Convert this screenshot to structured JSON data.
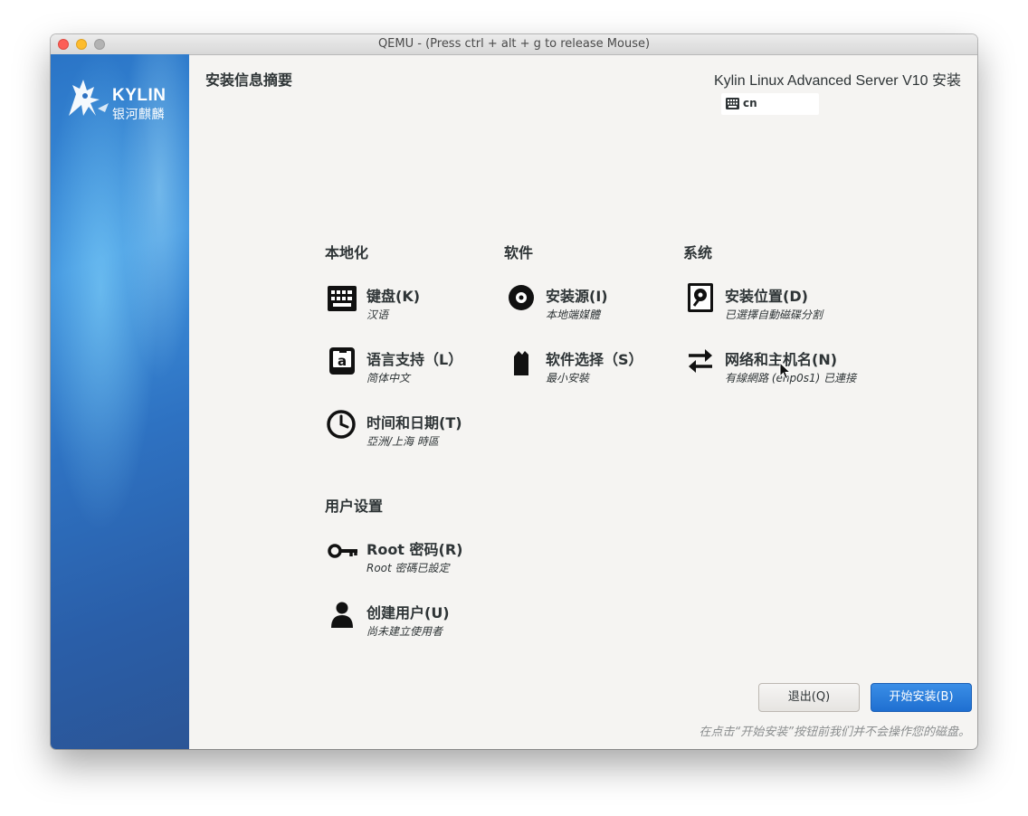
{
  "window": {
    "title": "QEMU - (Press ctrl + alt + g to release Mouse)"
  },
  "sidebar": {
    "logo_word": "KYLIN",
    "logo_cn": "银河麒麟",
    "logo_icon": "kylin-logo-icon"
  },
  "header": {
    "page_title": "安装信息摘要",
    "product_title": "Kylin Linux Advanced Server V10 安装",
    "keyboard_layout": "cn",
    "keyboard_icon": "keyboard-icon"
  },
  "sections": {
    "localization": {
      "title": "本地化",
      "spokes": [
        {
          "title": "键盘(K)",
          "status": "汉语",
          "icon": "keyboard-icon"
        },
        {
          "title": "语言支持（L）",
          "status": "简体中文",
          "icon": "language-icon"
        },
        {
          "title": "时间和日期(T)",
          "status": "亞洲/上海 時區",
          "icon": "clock-icon"
        }
      ]
    },
    "software": {
      "title": "软件",
      "spokes": [
        {
          "title": "安装源(I)",
          "status": "本地端媒體",
          "icon": "disc-icon"
        },
        {
          "title": "软件选择（S）",
          "status": "最小安裝",
          "icon": "package-icon"
        }
      ]
    },
    "system": {
      "title": "系统",
      "spokes": [
        {
          "title": "安装位置(D)",
          "status": "已選擇自動磁碟分割",
          "icon": "harddisk-icon"
        },
        {
          "title": "网络和主机名(N)",
          "status": "有線網路 (enp0s1) 已連接",
          "icon": "network-transfer-icon"
        }
      ]
    },
    "user_settings": {
      "title": "用户设置",
      "spokes": [
        {
          "title": "Root 密码(R)",
          "status": "Root 密碼已設定",
          "icon": "key-icon"
        },
        {
          "title": "创建用户(U)",
          "status": "尚未建立使用者",
          "icon": "user-icon"
        }
      ]
    }
  },
  "footer": {
    "quit_label": "退出(Q)",
    "begin_label": "开始安装(B)",
    "warning": "在点击“开始安装”按钮前我们并不会操作您的磁盘。"
  },
  "colors": {
    "accent": "#1f6fd1",
    "sidebar": "#2e72c2",
    "background": "#f5f4f2",
    "text": "#2e3436"
  }
}
